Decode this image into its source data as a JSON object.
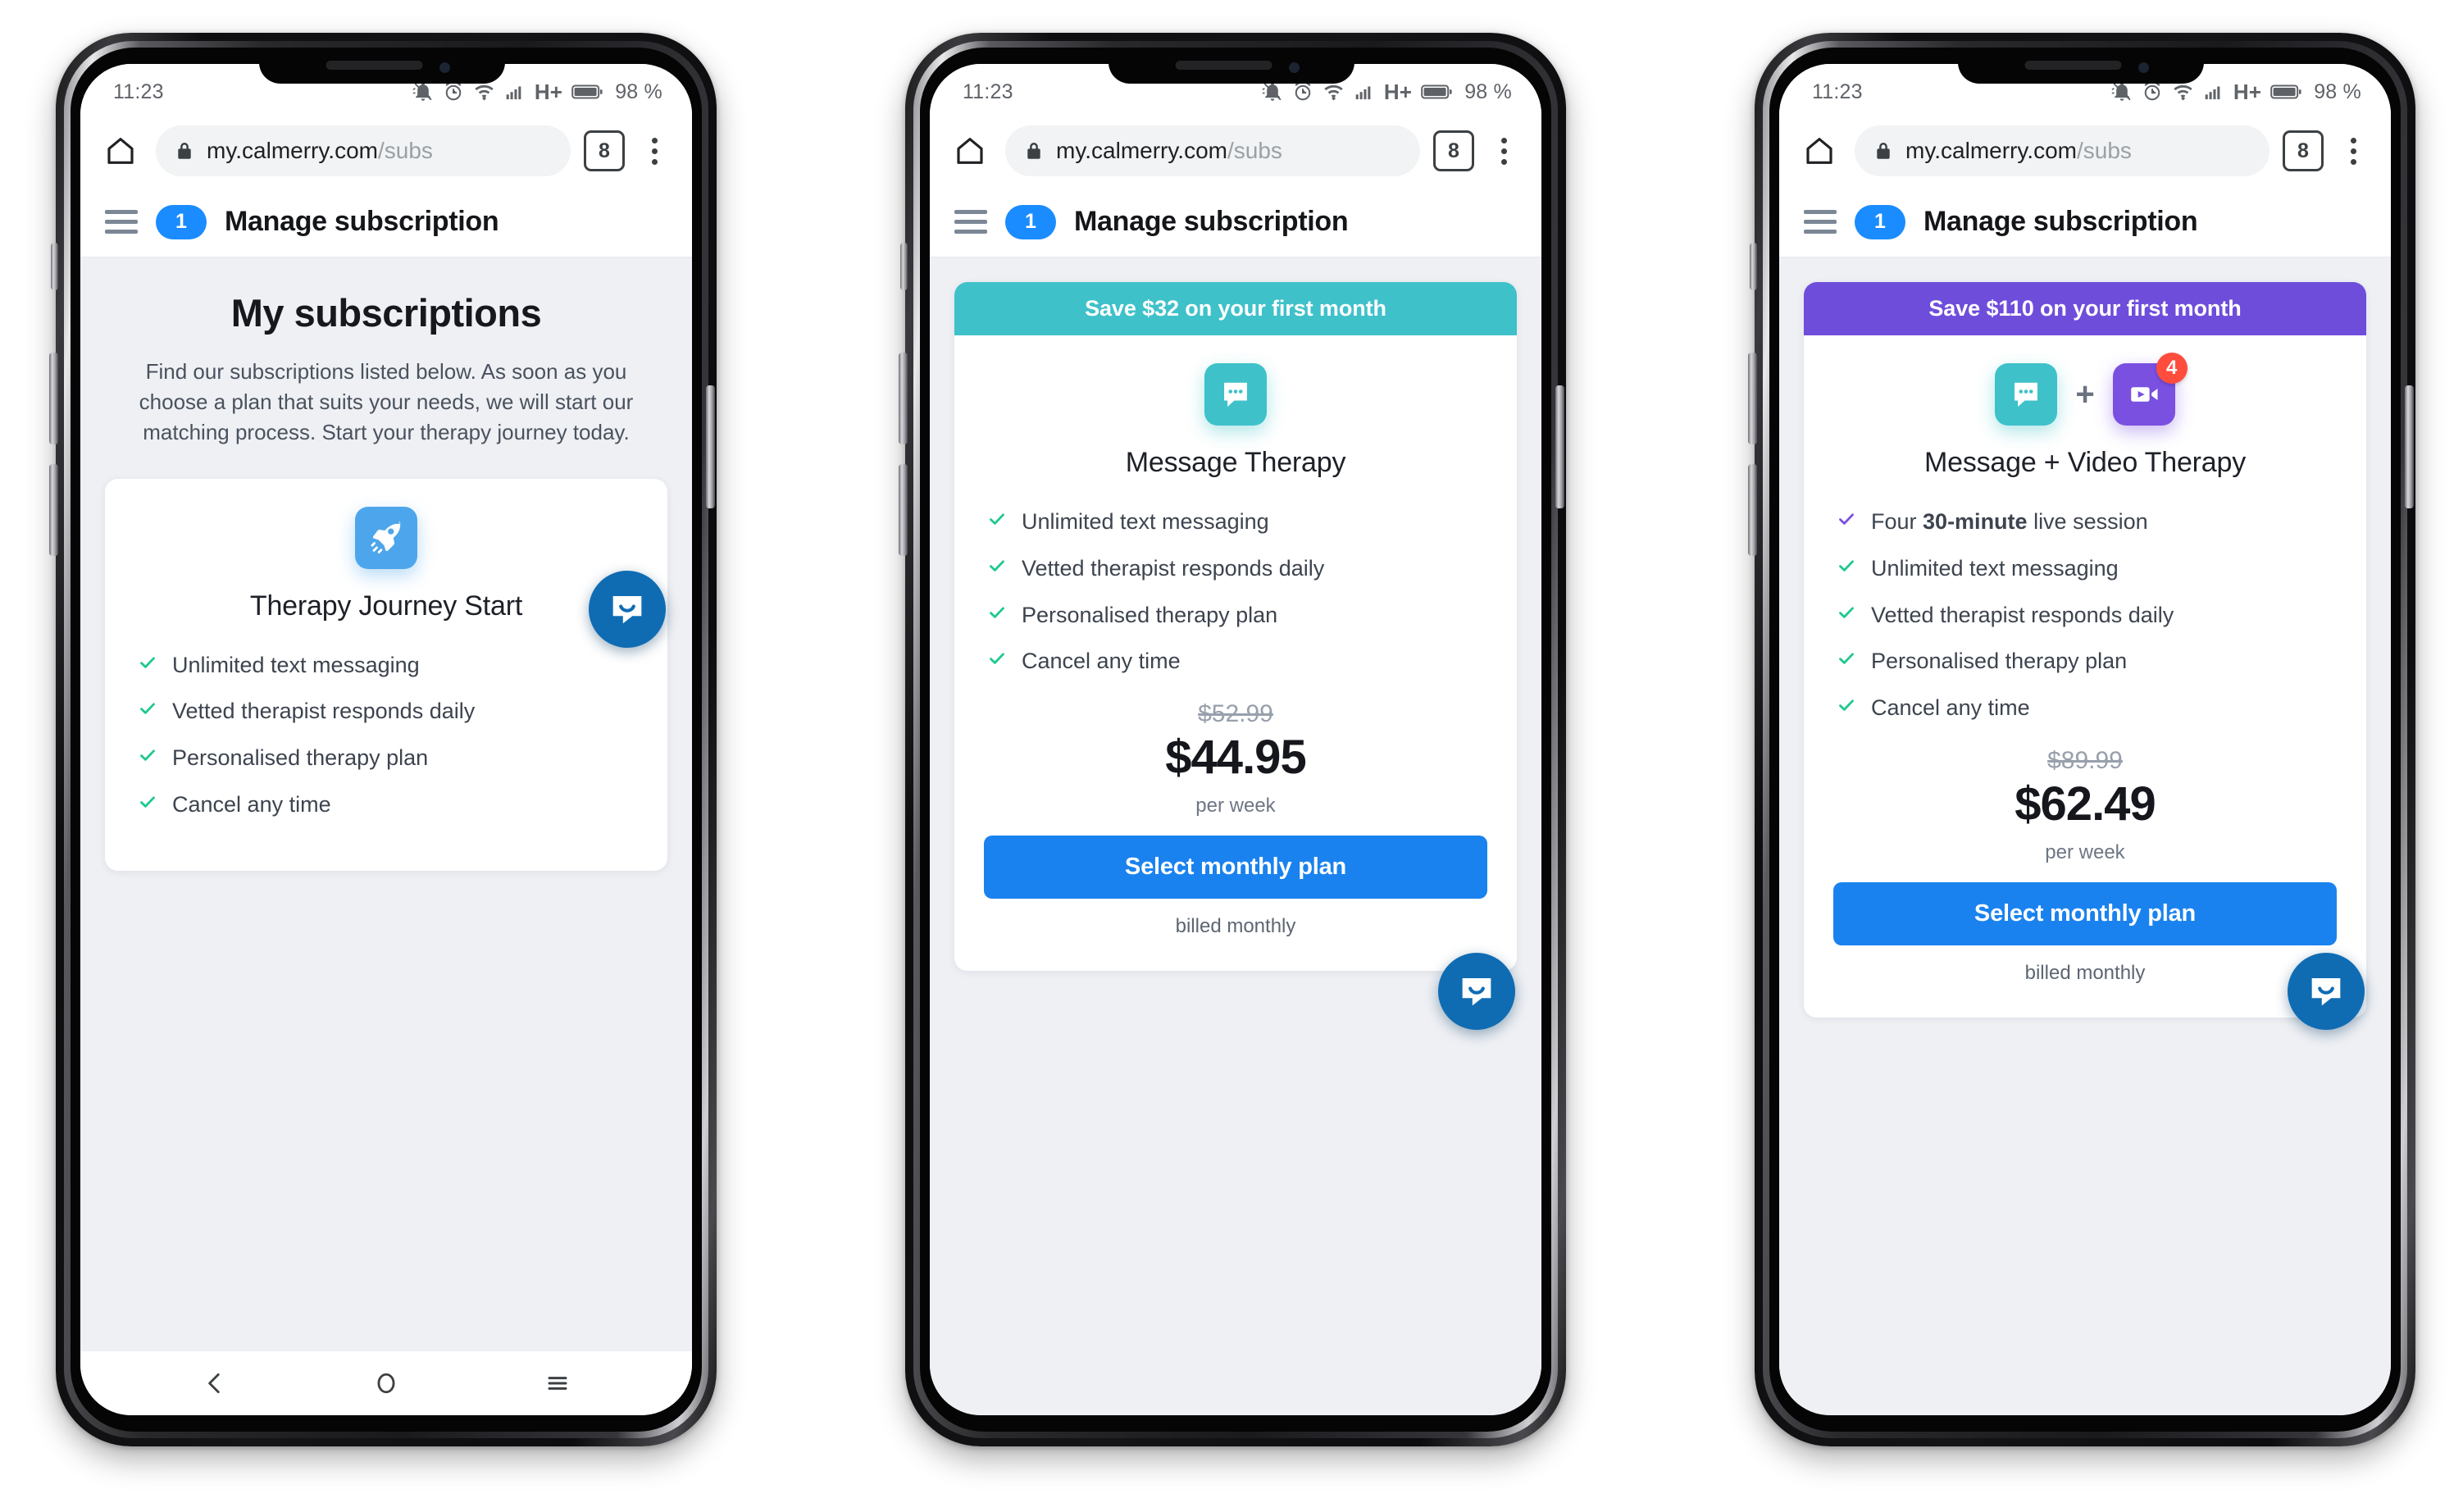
{
  "status_bar": {
    "time": "11:23",
    "battery_percent": "98 %",
    "network_type": "H+",
    "icons": [
      "bell-muted-icon",
      "alarm-clock-icon",
      "wifi-icon",
      "signal-bars-icon",
      "battery-icon"
    ]
  },
  "browser": {
    "url_domain": "my.calmerry.com",
    "url_path": "/subs",
    "tab_count": "8",
    "home_icon": "home-icon",
    "lock_icon": "lock-icon",
    "menu_icon": "kebab-menu-icon"
  },
  "app_header": {
    "menu_icon": "hamburger-icon",
    "badge": "1",
    "title": "Manage subscription"
  },
  "android_nav": {
    "back": "back-chevron-icon",
    "home": "home-circle-icon",
    "recents": "recents-icon"
  },
  "phones": [
    {
      "id": "phone-overview",
      "page": {
        "heading": "My subscriptions",
        "paragraph": "Find our subscriptions listed below. As soon as you choose a plan that suits your needs, we will start our matching process. Start your therapy journey today."
      },
      "card": {
        "banner": null,
        "banner_color": null,
        "icon_color": "#4da6eb",
        "icon_name": "rocket-icon",
        "secondary_icon": null,
        "icon_badge": null,
        "title": "Therapy Journey Start",
        "features": [
          {
            "text": "Unlimited text messaging",
            "bold": null,
            "check_color": "#1ec98d"
          },
          {
            "text": "Vetted therapist responds daily",
            "bold": null,
            "check_color": "#1ec98d"
          },
          {
            "text": "Personalised therapy plan",
            "bold": null,
            "check_color": "#1ec98d"
          },
          {
            "text": "Cancel any time",
            "bold": null,
            "check_color": "#1ec98d"
          }
        ],
        "price_old": null,
        "price_new": null,
        "price_period": null,
        "cta": null,
        "billed_note": null
      },
      "show_nav_bar": true
    },
    {
      "id": "phone-message-therapy",
      "page": {
        "heading": null,
        "paragraph": null
      },
      "card": {
        "banner": "Save $32 on your first month",
        "banner_color": "#3fc1ca",
        "icon_color": "#3fc1ca",
        "icon_name": "message-bubble-icon",
        "secondary_icon": null,
        "icon_badge": null,
        "title": "Message Therapy",
        "features": [
          {
            "text": "Unlimited text messaging",
            "bold": null,
            "check_color": "#1ec98d"
          },
          {
            "text": "Vetted therapist responds daily",
            "bold": null,
            "check_color": "#1ec98d"
          },
          {
            "text": "Personalised therapy plan",
            "bold": null,
            "check_color": "#1ec98d"
          },
          {
            "text": "Cancel any time",
            "bold": null,
            "check_color": "#1ec98d"
          }
        ],
        "price_old": "$52.99",
        "price_new": "$44.95",
        "price_period": "per week",
        "cta": "Select monthly plan",
        "billed_note": "billed monthly"
      },
      "show_nav_bar": false
    },
    {
      "id": "phone-message-video-therapy",
      "page": {
        "heading": null,
        "paragraph": null
      },
      "card": {
        "banner": "Save $110 on your first month",
        "banner_color": "#6f4ddb",
        "icon_color": "#3fc1ca",
        "icon_name": "message-bubble-icon",
        "secondary_icon": {
          "name": "video-camera-icon",
          "color": "#7a50e1"
        },
        "icon_badge": "4",
        "title": "Message + Video Therapy",
        "features": [
          {
            "text_before": "Four ",
            "bold": "30-minute",
            "text_after": " live session",
            "check_color": "#7a50e1"
          },
          {
            "text": "Unlimited text messaging",
            "bold": null,
            "check_color": "#1ec98d"
          },
          {
            "text": "Vetted therapist responds daily",
            "bold": null,
            "check_color": "#1ec98d"
          },
          {
            "text": "Personalised therapy plan",
            "bold": null,
            "check_color": "#1ec98d"
          },
          {
            "text": "Cancel any time",
            "bold": null,
            "check_color": "#1ec98d"
          }
        ],
        "price_old": "$89.99",
        "price_new": "$62.49",
        "price_period": "per week",
        "cta": "Select monthly plan",
        "billed_note": "billed monthly"
      },
      "show_nav_bar": false
    }
  ],
  "colors": {
    "accent_blue": "#1a82ef",
    "badge_blue": "#1a8cff",
    "teal": "#3fc1ca",
    "purple": "#6f4ddb",
    "green_check": "#1ec98d",
    "red_badge": "#ff4d3d",
    "intercom_blue": "#0f6cb3",
    "page_bg": "#eef0f4"
  },
  "chat_widget": {
    "icon": "intercom-chat-icon"
  }
}
